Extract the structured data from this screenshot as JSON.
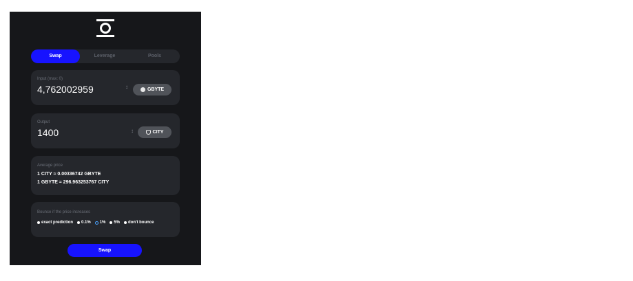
{
  "tabs": [
    {
      "label": "Swap",
      "active": true
    },
    {
      "label": "Leverage",
      "active": false
    },
    {
      "label": "Pools",
      "active": false
    }
  ],
  "input": {
    "label": "Input (max: 0)",
    "value": "4,762002959",
    "token": "GBYTE",
    "token_icon": "circle-token-icon"
  },
  "output": {
    "label": "Output",
    "value": "1400",
    "token": "CITY",
    "token_icon": "city-token-icon"
  },
  "average_price": {
    "label": "Average price",
    "line1": "1 CITY  ≈ 0.00336742 GBYTE",
    "line2": "1 GBYTE  ≈ 296.963253767 CITY"
  },
  "bounce": {
    "label": "Bounce if the price increases",
    "options": [
      {
        "label": "exact prediction",
        "selected": false
      },
      {
        "label": "0.1%",
        "selected": false
      },
      {
        "label": "1%",
        "selected": true
      },
      {
        "label": "5%",
        "selected": false
      },
      {
        "label": "don't bounce",
        "selected": false
      }
    ]
  },
  "swap_button": "Swap",
  "colors": {
    "accent": "#1713ff",
    "panel": "#16171a",
    "card": "#25272c",
    "token_button": "#505359",
    "selected_radio": "#4aa3ff"
  }
}
